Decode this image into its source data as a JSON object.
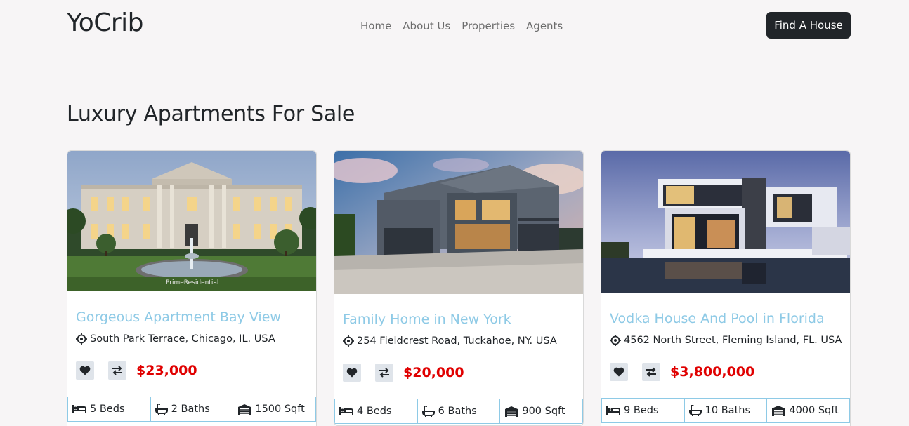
{
  "nav": {
    "brand": "YoCrib",
    "links": [
      "Home",
      "About Us",
      "Properties",
      "Agents"
    ],
    "cta": "Find A House"
  },
  "section": {
    "title": "Luxury Apartments For Sale"
  },
  "colors": {
    "accent": "#8ecae6",
    "price": "#e00000",
    "dark": "#212529"
  },
  "cards": [
    {
      "title": "Gorgeous Apartment Bay View",
      "address": "South Park Terrace, Chicago, IL. USA",
      "price": "$23,000",
      "beds": "5 Beds",
      "baths": "2 Baths",
      "area": "1500 Sqft",
      "watermark": "PrimeResidential"
    },
    {
      "title": "Family Home in New York",
      "address": "254 Fieldcrest Road, Tuckahoe, NY. USA",
      "price": "$20,000",
      "beds": "4 Beds",
      "baths": "6 Baths",
      "area": "900 Sqft"
    },
    {
      "title": "Vodka House And Pool in Florida",
      "address": "4562 North Street, Fleming Island, FL. USA",
      "price": "$3,800,000",
      "beds": "9 Beds",
      "baths": "10 Baths",
      "area": "4000 Sqft"
    }
  ]
}
